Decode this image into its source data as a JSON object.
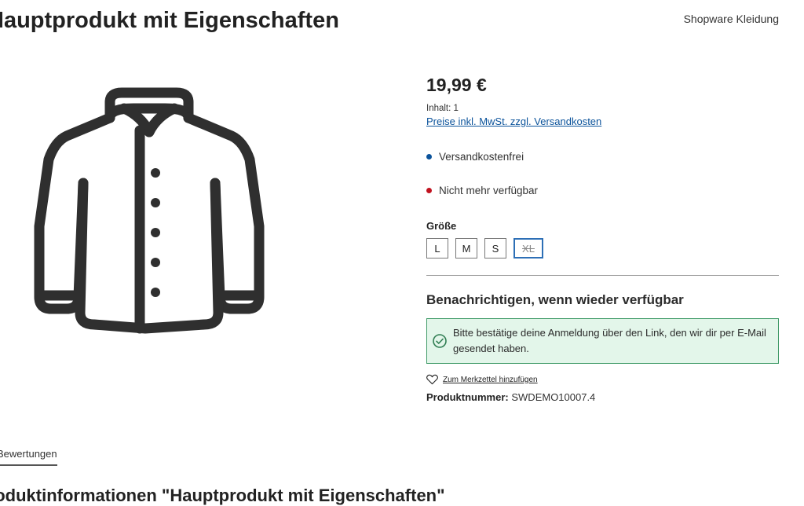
{
  "header": {
    "title": "Hauptprodukt mit Eigenschaften",
    "manufacturer": "Shopware Kleidung"
  },
  "product": {
    "image_icon": "jacket-icon",
    "price": "19,99 €",
    "content": "Inhalt: 1",
    "tax_link": "Preise inkl. MwSt. zzgl. Versandkosten",
    "shipping_free": "Versandkostenfrei",
    "availability": "Nicht mehr verfügbar",
    "status_colors": {
      "shipping": "#0b539b",
      "availability": "#c1121f"
    },
    "size_label": "Größe",
    "sizes": [
      {
        "label": "L",
        "selected": false
      },
      {
        "label": "M",
        "selected": false
      },
      {
        "label": "S",
        "selected": false
      },
      {
        "label": "XL",
        "selected": true
      }
    ],
    "notify_title": "Benachrichtigen, wenn wieder verfügbar",
    "alert_text": "Bitte bestätige deine Anmeldung über den Link, den wir dir per E-Mail gesendet haben.",
    "wishlist_label": "Zum Merkzettel hinzufügen",
    "product_number_label": "Produktnummer:",
    "product_number": "SWDEMO10007.4"
  },
  "tabs": {
    "active_label": "Bewertungen"
  },
  "section": {
    "title": "Produktinformationen \"Hauptprodukt mit Eigenschaften\""
  }
}
